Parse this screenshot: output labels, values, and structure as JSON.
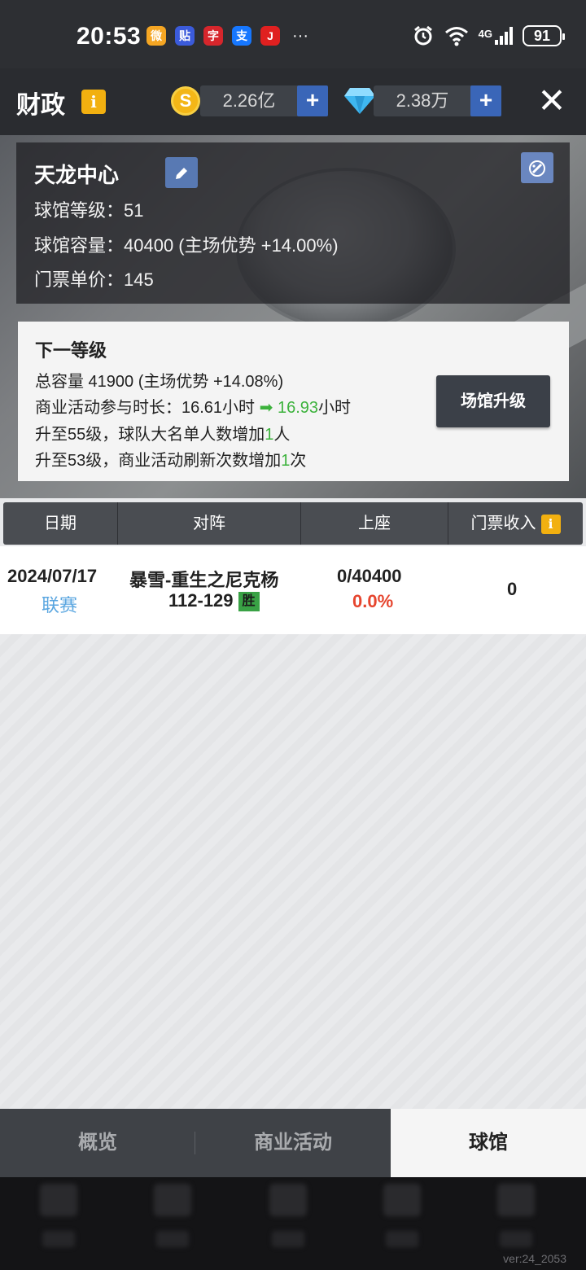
{
  "status_bar": {
    "time": "20:53",
    "apps": [
      {
        "icon": "weibo-icon",
        "glyph": "微",
        "color": "#f5a623"
      },
      {
        "icon": "tieba-icon",
        "glyph": "贴",
        "color": "#3b5bdb"
      },
      {
        "icon": "news-icon",
        "glyph": "字",
        "color": "#d6262c"
      },
      {
        "icon": "alipay-icon",
        "glyph": "支",
        "color": "#1677ff"
      },
      {
        "icon": "jump-icon",
        "glyph": "J",
        "color": "#e02020"
      }
    ],
    "more": "···",
    "network": "4G",
    "battery": "91"
  },
  "header": {
    "title": "财政",
    "info_glyph": "i",
    "coins": "2.26亿",
    "diamonds": "2.38万",
    "plus": "+",
    "close": "✕"
  },
  "venue": {
    "name": "天龙中心",
    "level_line": "球馆等级：51",
    "capacity_line": "球馆容量：40400 (主场优势 +14.00%)",
    "price_line": "门票单价：145"
  },
  "next_level": {
    "title": "下一等级",
    "capacity": "总容量  41900 (主场优势 +14.08%)",
    "duration_prefix": "商业活动参与时长：16.61小时",
    "duration_new": "16.93",
    "duration_suffix": "小时",
    "unlock1_prefix": "升至55级，球队大名单人数增加",
    "unlock1_num": "1",
    "unlock1_suffix": "人",
    "unlock2_prefix": "升至53级，商业活动刷新次数增加",
    "unlock2_num": "1",
    "unlock2_suffix": "次",
    "upgrade_button": "场馆升级"
  },
  "table": {
    "headers": [
      "日期",
      "对阵",
      "上座",
      "门票收入"
    ],
    "rows": [
      {
        "date": "2024/07/17",
        "type": "联赛",
        "match": "暴雪-重生之尼克杨",
        "score": "112-129",
        "result": "胜",
        "attendance": "0/40400",
        "attendance_rate": "0.0%",
        "revenue": "0"
      }
    ]
  },
  "tabs": [
    {
      "label": "概览",
      "active": false
    },
    {
      "label": "商业活动",
      "active": false
    },
    {
      "label": "球馆",
      "active": true
    }
  ],
  "version": "ver:24_2053"
}
